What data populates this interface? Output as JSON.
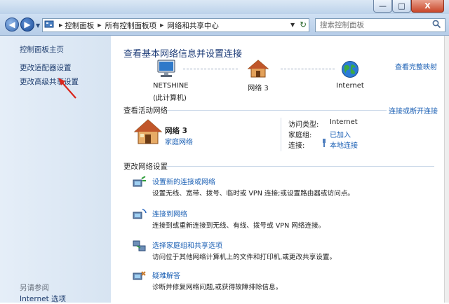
{
  "window": {
    "minimize": "—",
    "maximize": "□",
    "close": "X"
  },
  "nav": {
    "breadcrumb": [
      "控制面板",
      "所有控制面板项",
      "网络和共享中心"
    ],
    "search_placeholder": "搜索控制面板"
  },
  "sidebar": {
    "home": "控制面板主页",
    "items": [
      "更改适配器设置",
      "更改高级共享设置"
    ],
    "see_also_title": "另请参阅",
    "see_also": [
      "Internet 选项"
    ]
  },
  "main": {
    "title": "查看基本网络信息并设置连接",
    "full_map": "查看完整映射",
    "map": {
      "computer_name": "NETSHINE",
      "computer_sub": "(此计算机)",
      "network_name": "网络 3",
      "internet_label": "Internet"
    },
    "active": {
      "title": "查看活动网络",
      "connect_link": "连接或断开连接",
      "network_name": "网络 3",
      "network_type": "家庭网络",
      "access_type_label": "访问类型:",
      "access_type_value": "Internet",
      "homegroup_label": "家庭组:",
      "homegroup_value": "已加入",
      "connection_label": "连接:",
      "connection_value": "本地连接"
    },
    "change": {
      "title": "更改网络设置",
      "items": [
        {
          "link": "设置新的连接或网络",
          "desc": "设置无线、宽带、拨号、临时或 VPN 连接;或设置路由器或访问点。"
        },
        {
          "link": "连接到网络",
          "desc": "连接到或重新连接到无线、有线、拨号或 VPN 网络连接。"
        },
        {
          "link": "选择家庭组和共享选项",
          "desc": "访问位于其他网络计算机上的文件和打印机,或更改共享设置。"
        },
        {
          "link": "疑难解答",
          "desc": "诊断并修复网络问题,或获得故障排除信息。"
        }
      ]
    }
  },
  "colors": {
    "link": "#1a5fb4",
    "header": "#1e3c78",
    "sidebar": "#dde8f4",
    "annotation": "#d9261c"
  }
}
